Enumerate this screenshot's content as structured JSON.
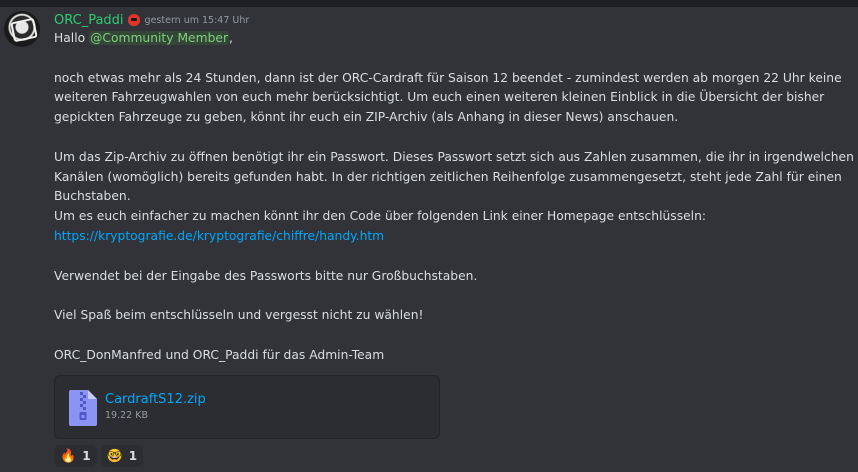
{
  "message": {
    "author": "ORC_Paddi",
    "timestamp": "gestern um 15:47 Uhr",
    "greeting": "Hallo",
    "mention": "@Community Member",
    "greeting_suffix": ",",
    "para1": "noch etwas mehr als 24 Stunden, dann ist der ORC-Cardraft für Saison 12 beendet - zumindest werden ab morgen 22 Uhr keine weiteren Fahrzeugwahlen von euch mehr berücksichtigt. Um euch einen weiteren kleinen Einblick in die Übersicht der bisher gepickten Fahrzeuge zu geben, könnt ihr euch ein ZIP-Archiv (als Anhang in dieser News) anschauen.",
    "para2": "Um das Zip-Archiv zu öffnen benötigt ihr ein Passwort. Dieses Passwort setzt sich aus Zahlen zusammen, die ihr in irgendwelchen Kanälen (womöglich) bereits gefunden habt. In der richtigen zeitlichen Reihenfolge zusammengesetzt, steht jede Zahl für einen Buchstaben.",
    "para3": "Um es euch einfacher zu machen könnt ihr den Code über folgenden Link einer Homepage entschlüsseln:",
    "link": "https://kryptografie.de/kryptografie/chiffre/handy.htm",
    "para4": "Verwendet bei der Eingabe des Passworts bitte nur Großbuchstaben.",
    "para5": "Viel Spaß beim entschlüsseln und vergesst nicht zu wählen!",
    "signature": "ORC_DonManfred und ORC_Paddi für das Admin-Team"
  },
  "attachment": {
    "file_name": "CardraftS12.zip",
    "file_size": "19.22 KB",
    "icon": "zip-file-icon"
  },
  "reactions": [
    {
      "emoji": "🔥",
      "icon": "fire-emoji",
      "count": "1"
    },
    {
      "emoji": "🤓",
      "icon": "nerd-face-emoji",
      "count": "1"
    }
  ],
  "colors": {
    "background": "#313338",
    "username": "#2ecc71",
    "link": "#00a8fc",
    "mention": "#7ed07b"
  }
}
